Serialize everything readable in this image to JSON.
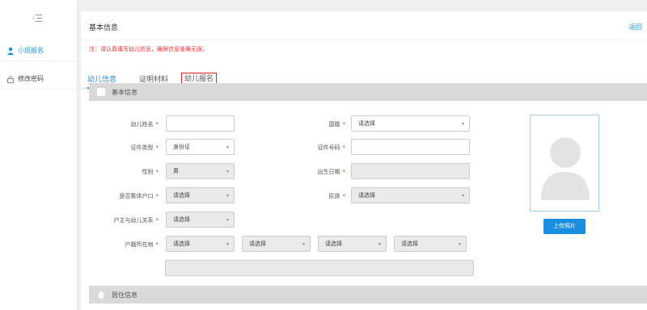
{
  "sidebar": {
    "items": [
      {
        "label": "小班报名",
        "active": true,
        "icon": "user-icon"
      },
      {
        "label": "修改密码",
        "active": false,
        "icon": "lock-icon"
      }
    ]
  },
  "header": {
    "title": "基本信息",
    "back": "返回"
  },
  "notice": "注：请认真填写幼儿信息，确保信息准确无误。",
  "tabs": [
    "幼儿信息",
    "证明材料",
    "幼儿报名"
  ],
  "sections": {
    "basic": "基本信息",
    "residence": "居住信息"
  },
  "form": {
    "name": {
      "label": "幼儿姓名",
      "value": ""
    },
    "nationality": {
      "label": "国籍",
      "value": "请选择"
    },
    "id_type": {
      "label": "证件类型",
      "value": "身份证"
    },
    "id_number": {
      "label": "证件号码",
      "value": ""
    },
    "gender": {
      "label": "性别",
      "value": "男"
    },
    "birth_date": {
      "label": "出生日期",
      "value": ""
    },
    "collective_household": {
      "label": "是否集体户口",
      "value": "请选择"
    },
    "ethnicity": {
      "label": "民族",
      "value": "请选择"
    },
    "household_relation": {
      "label": "户主与幼儿关系",
      "value": "请选择"
    },
    "household_location": {
      "label": "户籍所在地",
      "values": [
        "请选择",
        "请选择",
        "请选择",
        "请选择"
      ]
    }
  },
  "photo": {
    "upload_label": "上传照片"
  },
  "colors": {
    "accent": "#1a8fe0",
    "warning": "#e33333",
    "tab_highlight": "#d22222"
  }
}
